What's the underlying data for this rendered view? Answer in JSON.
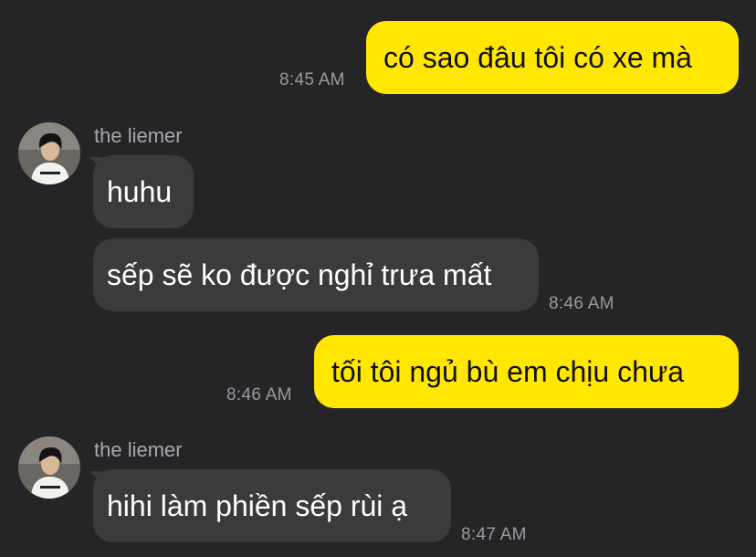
{
  "colors": {
    "background": "#252527",
    "outgoing_bubble": "#FFE700",
    "incoming_bubble": "#3B3B3E",
    "timestamp": "#9A9A9E",
    "sender_name": "#A8A8AC"
  },
  "messages": [
    {
      "direction": "outgoing",
      "text": "có sao đâu tôi có xe mà",
      "time": "8:45 AM"
    },
    {
      "direction": "incoming",
      "sender": "the liemer",
      "avatar_icon": "user-avatar",
      "text": "huhu"
    },
    {
      "direction": "incoming",
      "text": "sếp sẽ ko được nghỉ trưa mất",
      "time": "8:46 AM"
    },
    {
      "direction": "outgoing",
      "text": "tối tôi ngủ bù em chịu chưa",
      "time": "8:46 AM"
    },
    {
      "direction": "incoming",
      "sender": "the liemer",
      "avatar_icon": "user-avatar",
      "text": "hihi làm phiền sếp rùi ạ",
      "time": "8:47 AM"
    }
  ]
}
